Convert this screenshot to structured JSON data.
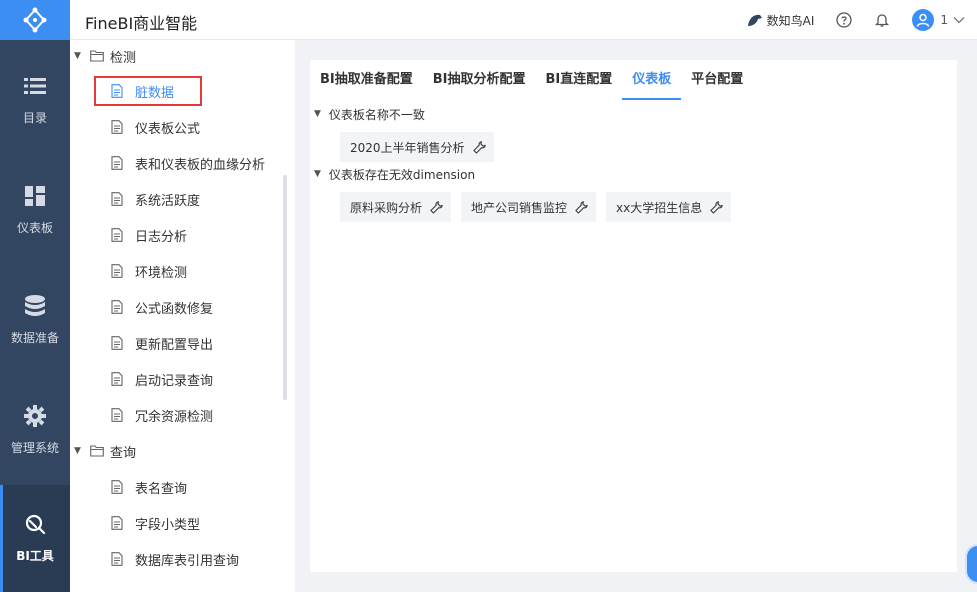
{
  "app": {
    "title": "FineBI商业智能"
  },
  "topbar": {
    "ai_label": "数知鸟AI",
    "user": "1"
  },
  "leftnav": {
    "items": [
      {
        "label": "目录",
        "icon": "list-icon"
      },
      {
        "label": "仪表板",
        "icon": "dashboard-icon"
      },
      {
        "label": "数据准备",
        "icon": "database-icon"
      },
      {
        "label": "管理系统",
        "icon": "gear-icon"
      },
      {
        "label": "BI工具",
        "icon": "tool-icon"
      }
    ],
    "active": "BI工具"
  },
  "tree": {
    "groups": [
      {
        "label": "检测",
        "children": [
          "脏数据",
          "仪表板公式",
          "表和仪表板的血缘分析",
          "系统活跃度",
          "日志分析",
          "环境检测",
          "公式函数修复",
          "更新配置导出",
          "启动记录查询",
          "冗余资源检测"
        ]
      },
      {
        "label": "查询",
        "children": [
          "表名查询",
          "字段小类型",
          "数据库表引用查询"
        ]
      }
    ],
    "selected": "脏数据"
  },
  "main": {
    "tabs": [
      "BI抽取准备配置",
      "BI抽取分析配置",
      "BI直连配置",
      "仪表板",
      "平台配置"
    ],
    "active_tab": "仪表板",
    "sections": [
      {
        "title": "仪表板名称不一致",
        "items": [
          "2020上半年销售分析"
        ]
      },
      {
        "title": "仪表板存在无效dimension",
        "items": [
          "原料采购分析",
          "地产公司销售监控",
          "xx大学招生信息"
        ]
      }
    ]
  },
  "colors": {
    "accent": "#3d8ef3",
    "nav_bg": "#324561",
    "highlight_border": "#e23b3b"
  }
}
